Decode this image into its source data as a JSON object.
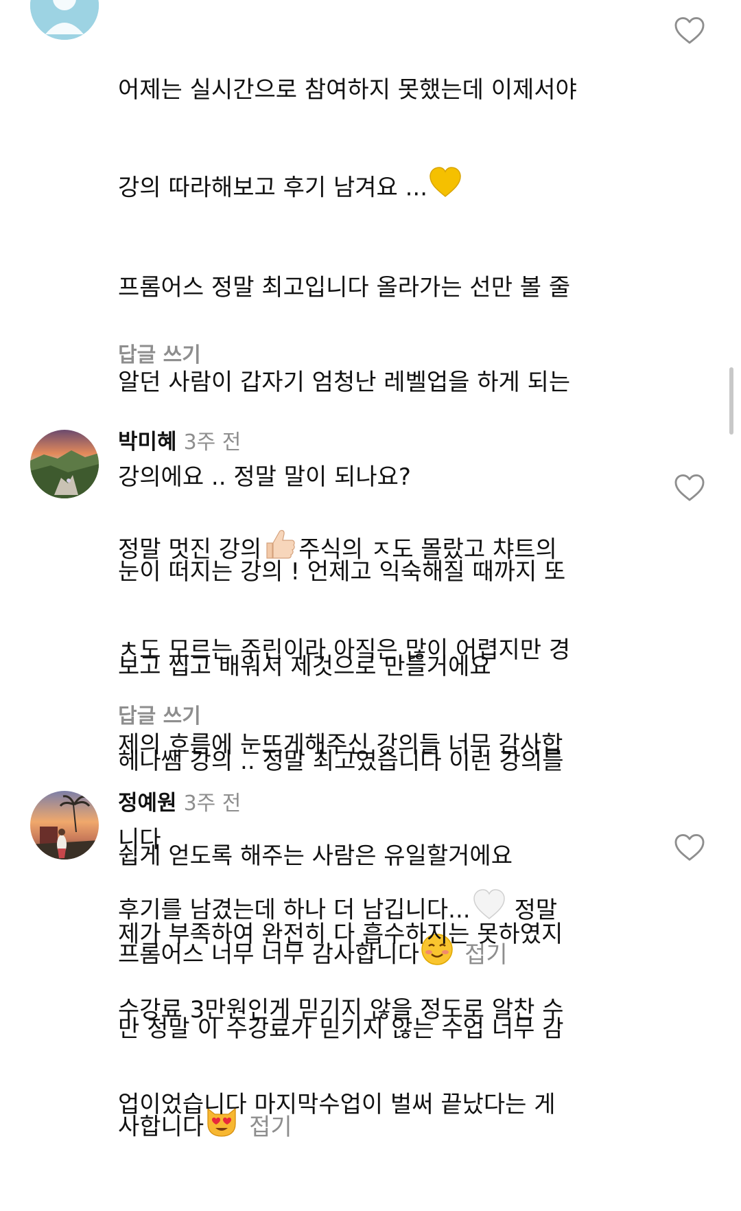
{
  "comments": [
    {
      "author": "",
      "time": "",
      "lines": [
        "어제는 실시간으로 참여하지 못했는데 이제서야",
        "강의 따라해보고 후기 남겨요 ...",
        "프롬어스 정말 최고입니다 올라가는 선만 볼 줄",
        "알던 사람이 갑자기 엄청난 레벨업을 하게 되는",
        "강의에요 .. 정말 말이 되나요?",
        "눈이 떠지는 강의 ! 언제고 익숙해질 때까지 또",
        "보고 씹고 배워서 제것으로 만들거에요",
        "헤나쌤 강의 .. 정말 최고였습니다 이런 강의를",
        "쉽게 얻도록 해주는 사람은 유일할거에요",
        "프롬어스 너무 너무 감사합니다"
      ],
      "collapse": "접기",
      "reply": "답글 쓰기"
    },
    {
      "author": "박미혜",
      "time": "3주 전",
      "lines": [
        "정말 멋진 강의",
        "주식의 ㅈ도 몰랐고 챠트의",
        "ㅊ도 모르는 주린이라 아직은 많이 어렵지만 경",
        "제의 흐름에 눈뜨게해주신 강의들 너무 감사합",
        "니다",
        "제가 부족하여 완전히 다 흡수하지는 못하였지",
        "만 정말 이 수강료가 믿기지 않는 수업 너무 감",
        "사합니다"
      ],
      "collapse": "접기",
      "reply": "답글 쓰기"
    },
    {
      "author": "정예원",
      "time": "3주 전",
      "lines": [
        "후기를 남겼는데 하나 더 남깁니다...",
        "정말",
        "수강료 3만원인게 믿기지 않을 정도로 알찬 수",
        "업이었습니다 마지막수업이 벌써 끝났다는 게"
      ]
    }
  ],
  "icons": {
    "like": "heart-outline-icon",
    "emoji_yellow_heart": "yellow-heart-emoji",
    "emoji_smiling": "smiling-face-emoji",
    "emoji_thumbs_up": "thumbs-up-emoji",
    "emoji_heart_eyes_cat": "heart-eyes-cat-emoji",
    "emoji_white_heart": "white-heart-emoji"
  },
  "colors": {
    "text": "#111111",
    "muted": "#8e8e8e",
    "icon": "#8e8e8e"
  }
}
